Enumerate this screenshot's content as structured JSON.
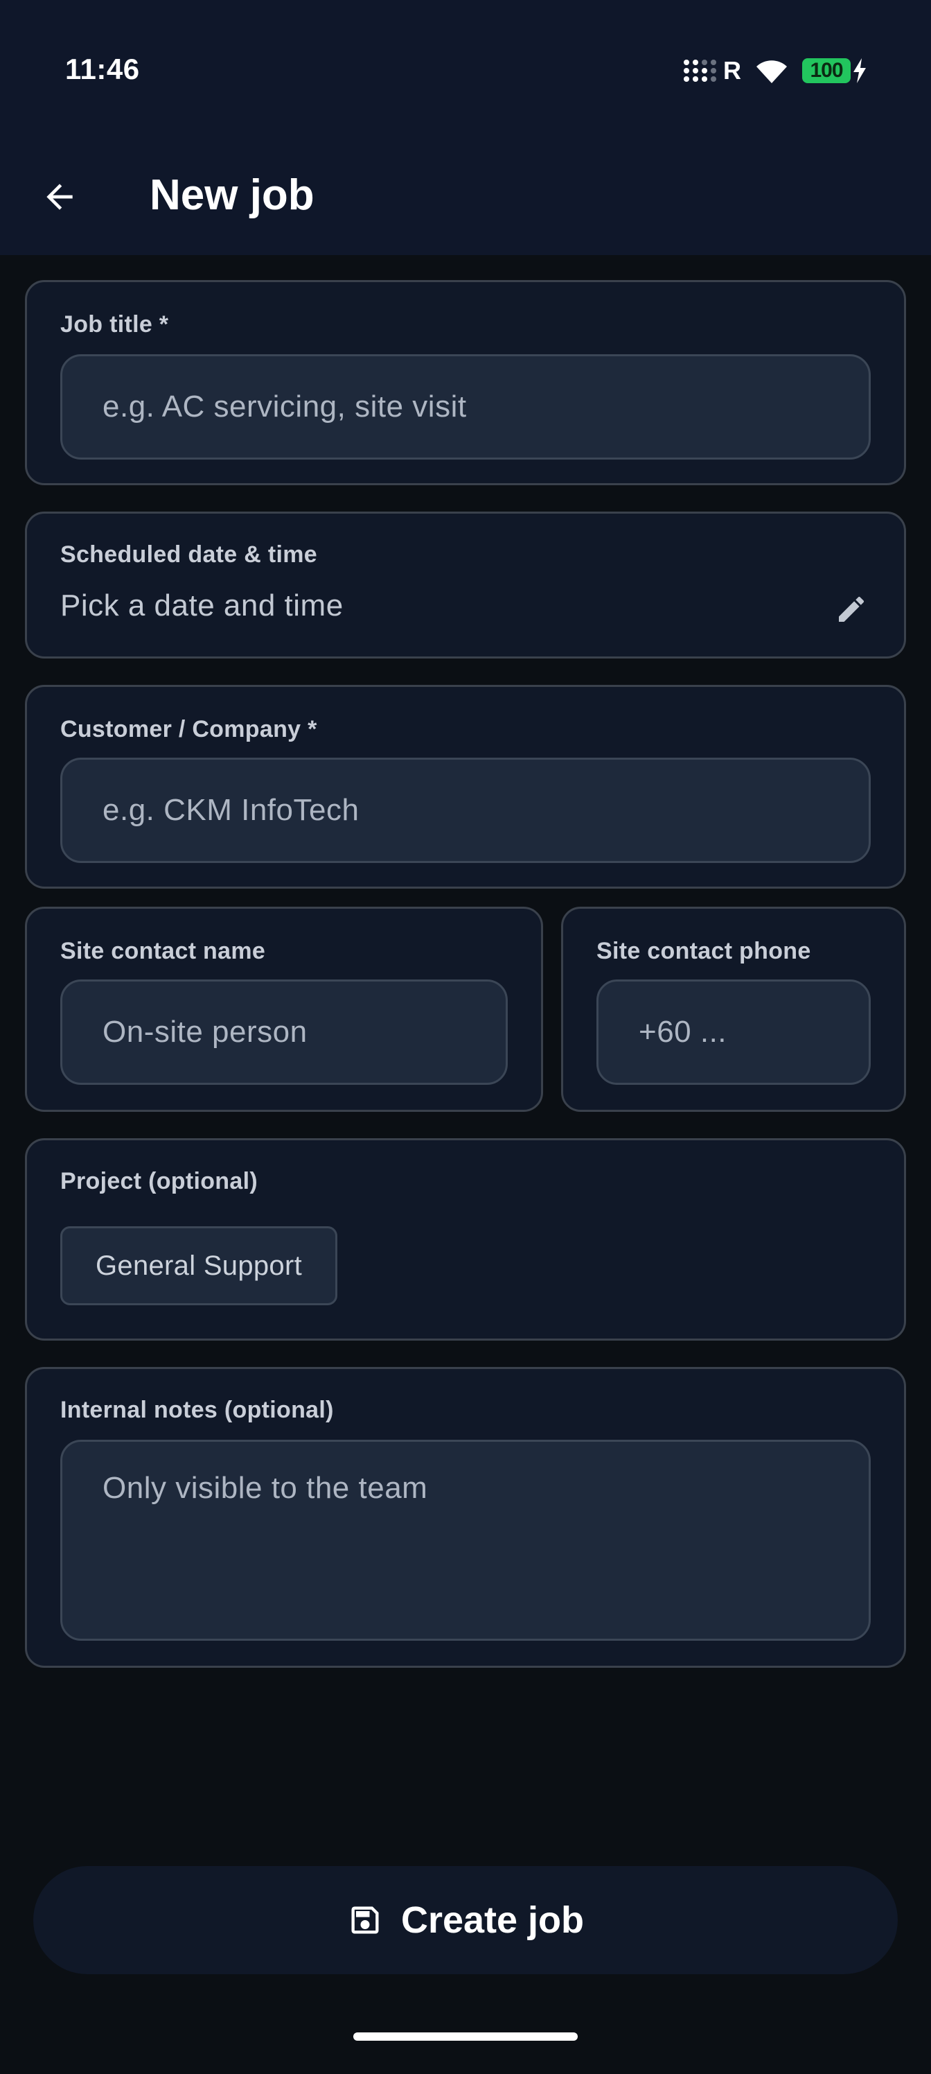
{
  "status_bar": {
    "time": "11:46",
    "roaming": "R",
    "battery": "100",
    "battery_color": "#22c55e"
  },
  "app_bar": {
    "title": "New job",
    "back_icon": "arrow-left-icon"
  },
  "form": {
    "job_title": {
      "label": "Job title *",
      "value": "",
      "placeholder": "e.g. AC servicing, site visit"
    },
    "scheduled": {
      "label": "Scheduled date & time",
      "value": "Pick a date and time",
      "edit_icon": "pencil-icon"
    },
    "customer": {
      "label": "Customer / Company *",
      "value": "",
      "placeholder": "e.g. CKM InfoTech"
    },
    "contact_name": {
      "label": "Site contact name",
      "value": "",
      "placeholder": "On-site person"
    },
    "contact_phone": {
      "label": "Site contact phone",
      "value": "",
      "placeholder": "+60 ..."
    },
    "project": {
      "label": "Project (optional)",
      "selected": "General Support"
    },
    "notes": {
      "label": "Internal notes (optional)",
      "value": "",
      "placeholder": "Only visible to the team"
    }
  },
  "actions": {
    "create_label": "Create job",
    "create_icon": "save-icon"
  },
  "colors": {
    "background": "#0b0f14",
    "surface": "#101828",
    "field": "#1e293b"
  }
}
